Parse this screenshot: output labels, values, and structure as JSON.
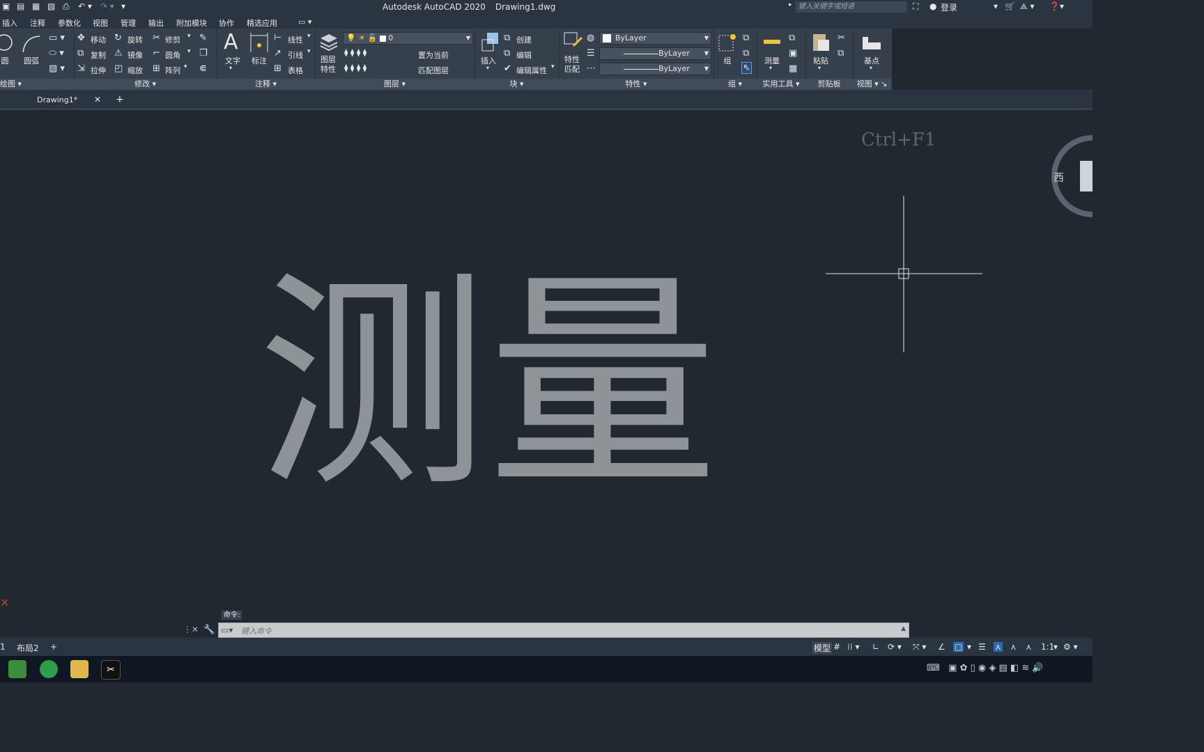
{
  "app": {
    "title": "Autodesk AutoCAD 2020",
    "filename": "Drawing1.dwg",
    "search_placeholder": "键入关键字或短语",
    "login_label": "登录"
  },
  "menu": [
    "插入",
    "注释",
    "参数化",
    "视图",
    "管理",
    "输出",
    "附加模块",
    "协作",
    "精选应用"
  ],
  "ribbon": {
    "draw": {
      "circle": "圆",
      "arc": "圆弧",
      "title": "绘图"
    },
    "modify": {
      "move": "移动",
      "rotate": "旋转",
      "trim": "修剪",
      "copy": "复制",
      "mirror": "镜像",
      "fillet": "圆角",
      "stretch": "拉伸",
      "scale": "缩放",
      "array": "阵列",
      "title": "修改"
    },
    "annotation": {
      "text": "文字",
      "dimension": "标注",
      "linear": "线性",
      "leader": "引线",
      "table": "表格",
      "title": "注释"
    },
    "layers": {
      "layer_props": "图层特性",
      "layer_value": "0",
      "set_current": "置为当前",
      "match_layer": "匹配图层",
      "title": "图层"
    },
    "block": {
      "insert": "插入",
      "create": "创建",
      "edit": "编辑",
      "edit_attr": "编辑属性",
      "title": "块"
    },
    "properties": {
      "match": "特性匹配",
      "color": "ByLayer",
      "linetype": "ByLayer",
      "lineweight": "ByLayer",
      "title": "特性"
    },
    "groups": {
      "group": "组",
      "title": "组"
    },
    "utilities": {
      "measure": "测量",
      "title": "实用工具"
    },
    "clipboard": {
      "paste": "粘贴",
      "title": "剪贴板"
    },
    "view": {
      "base": "基点",
      "title": "视图"
    }
  },
  "tabs": {
    "drawing": "Drawing1*"
  },
  "canvas": {
    "text": "测量",
    "tooltip": "Ctrl+F1",
    "viewcube_west": "西"
  },
  "command": {
    "label": "命令:",
    "placeholder": "键入命令"
  },
  "layouts": [
    "1",
    "布局2"
  ],
  "status": {
    "model": "模型",
    "scale": "1:1"
  }
}
